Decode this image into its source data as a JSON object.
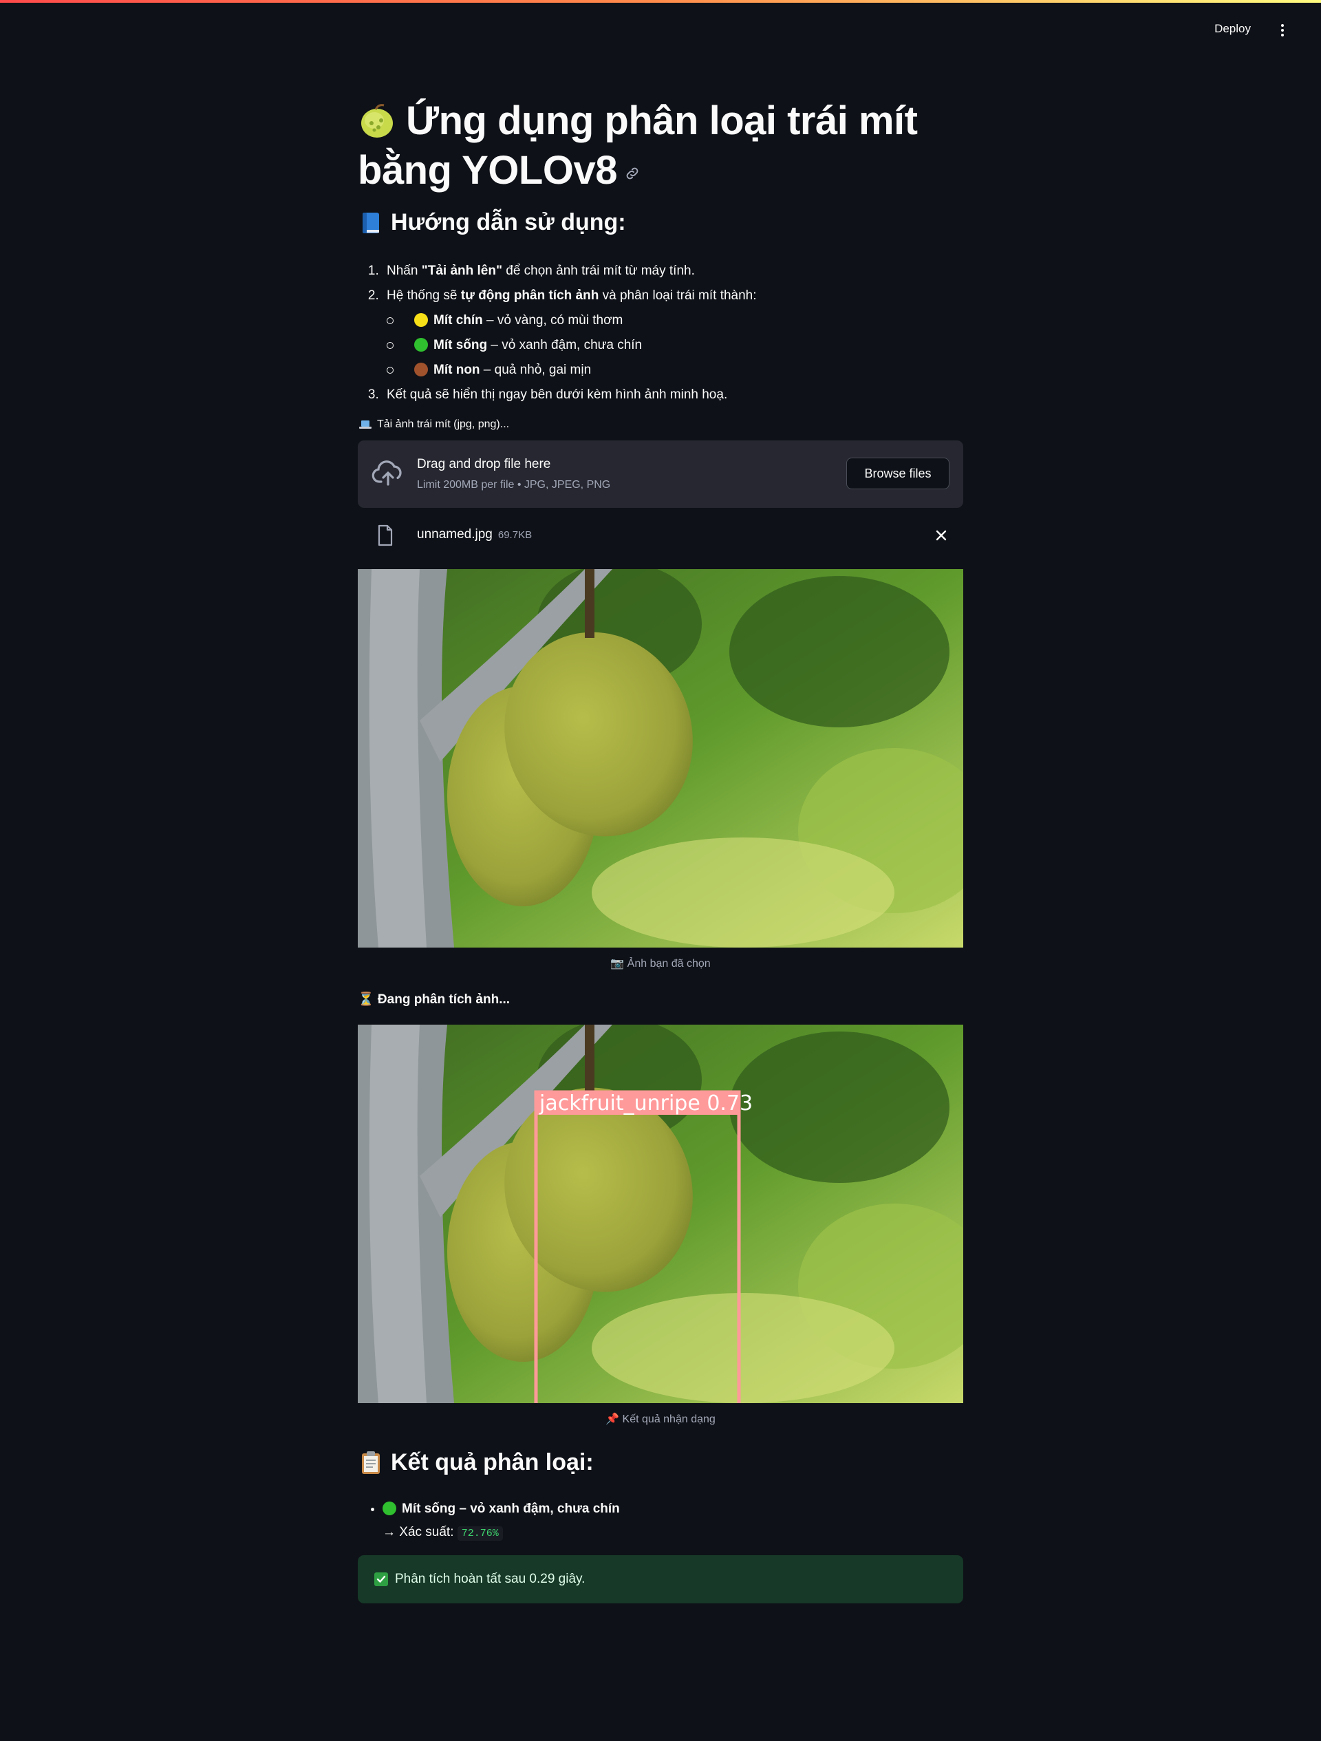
{
  "header": {
    "deploy_label": "Deploy",
    "menu_icon": "vertical-ellipsis-icon"
  },
  "title": {
    "emoji_icon": "melon-icon",
    "text": "Ứng dụng phân loại trái mít bằng YOLOv8",
    "anchor_icon": "link-icon"
  },
  "guide": {
    "heading_icon": "blue-book-icon",
    "heading": "Hướng dẫn sử dụng:",
    "step1": {
      "pre": "Nhấn ",
      "bold": "\"Tải ảnh lên\"",
      "post": " để chọn ảnh trái mít từ máy tính."
    },
    "step2": {
      "pre": "Hệ thống sẽ ",
      "bold": "tự động phân tích ảnh",
      "post": " và phân loại trái mít thành:"
    },
    "classes": [
      {
        "name": "Mít chín",
        "desc": " – vỏ vàng, có mùi thơm",
        "color": "#f7e018"
      },
      {
        "name": "Mít sống",
        "desc": " – vỏ xanh đậm, chưa chín",
        "color": "#2fbf2f"
      },
      {
        "name": "Mít non",
        "desc": " – quả nhỏ, gai mịn",
        "color": "#a0522d"
      }
    ],
    "step3": "Kết quả sẽ hiển thị ngay bên dưới kèm hình ảnh minh hoạ."
  },
  "uploader": {
    "label_icon": "laptop-icon",
    "label": "Tải ảnh trái mít (jpg, png)...",
    "drop_title": "Drag and drop file here",
    "drop_sub": "Limit 200MB per file • JPG, JPEG, PNG",
    "browse_label": "Browse files",
    "file_name": "unnamed.jpg",
    "file_size": "69.7KB"
  },
  "images": {
    "caption_original": "📷 Ảnh bạn đã chọn",
    "analyzing": "⏳ Đang phân tích ảnh...",
    "detection_label": "jackfruit_unripe 0.73",
    "caption_result": "📌 Kết quả nhận dạng"
  },
  "results": {
    "heading_icon": "clipboard-icon",
    "heading": "Kết quả phân loại:",
    "item_label": "Mít sống – vỏ xanh đậm, chưa chín",
    "item_color": "#2fbf2f",
    "prob_label": "→ Xác suất:",
    "prob_value": "72.76%"
  },
  "status": {
    "message": "Phân tích hoàn tất sau 0.29 giây."
  }
}
